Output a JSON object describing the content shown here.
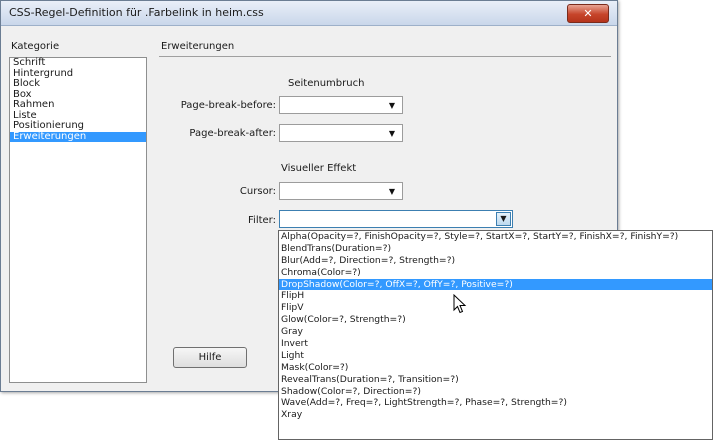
{
  "window": {
    "title": "CSS-Regel-Definition für .Farbelink in heim.css",
    "close_label": "✕"
  },
  "categories": {
    "label": "Kategorie",
    "items": [
      "Schrift",
      "Hintergrund",
      "Block",
      "Box",
      "Rahmen",
      "Liste",
      "Positionierung",
      "Erweiterungen"
    ],
    "selected": "Erweiterungen"
  },
  "section": {
    "title": "Erweiterungen",
    "page_break_group": "Seitenumbruch",
    "page_break_before_label": "Page-break-before:",
    "page_break_before_value": "",
    "page_break_after_label": "Page-break-after:",
    "page_break_after_value": "",
    "visual_group": "Visueller Effekt",
    "cursor_label": "Cursor:",
    "cursor_value": "",
    "filter_label": "Filter:",
    "filter_value": ""
  },
  "help_label": "Hilfe",
  "filter_options": [
    "Alpha(Opacity=?, FinishOpacity=?, Style=?, StartX=?, StartY=?, FinishX=?, FinishY=?)",
    "BlendTrans(Duration=?)",
    "Blur(Add=?, Direction=?, Strength=?)",
    "Chroma(Color=?)",
    "DropShadow(Color=?, OffX=?, OffY=?, Positive=?)",
    "FlipH",
    "FlipV",
    "Glow(Color=?, Strength=?)",
    "Gray",
    "Invert",
    "Light",
    "Mask(Color=?)",
    "RevealTrans(Duration=?, Transition=?)",
    "Shadow(Color=?, Direction=?)",
    "Wave(Add=?, Freq=?, LightStrength=?, Phase=?, Strength=?)",
    "Xray"
  ],
  "highlighted_option": "DropShadow(Color=?, OffX=?, OffY=?, Positive=?)",
  "colors": {
    "selection": "#3399ff",
    "dialog_bg": "#f0f0f0"
  }
}
